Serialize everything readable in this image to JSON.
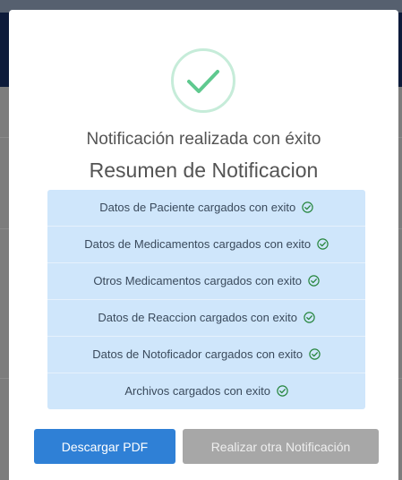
{
  "modal": {
    "title": "Notificación realizada con éxito",
    "subtitle": "Resumen de Notificacion",
    "success_icon": "check-circle-icon",
    "summary_items": [
      {
        "label": "Datos de Paciente cargados con exito",
        "icon": "check-circle-icon"
      },
      {
        "label": "Datos de Medicamentos cargados con exito",
        "icon": "check-circle-icon"
      },
      {
        "label": "Otros Medicamentos cargados con exito",
        "icon": "check-circle-icon"
      },
      {
        "label": "Datos de Reaccion cargados con exito",
        "icon": "check-circle-icon"
      },
      {
        "label": "Datos de Notoficador cargados con exito",
        "icon": "check-circle-icon"
      },
      {
        "label": "Archivos cargados con exito",
        "icon": "check-circle-icon"
      }
    ],
    "buttons": {
      "download_label": "Descargar PDF",
      "new_label": "Realizar otra Notificación"
    }
  },
  "colors": {
    "success": "#a5dc86",
    "summary_bg": "#cfe6fb",
    "primary": "#2f80d6",
    "secondary": "#a7a7a7",
    "backdrop_header": "#0d1b3a"
  }
}
